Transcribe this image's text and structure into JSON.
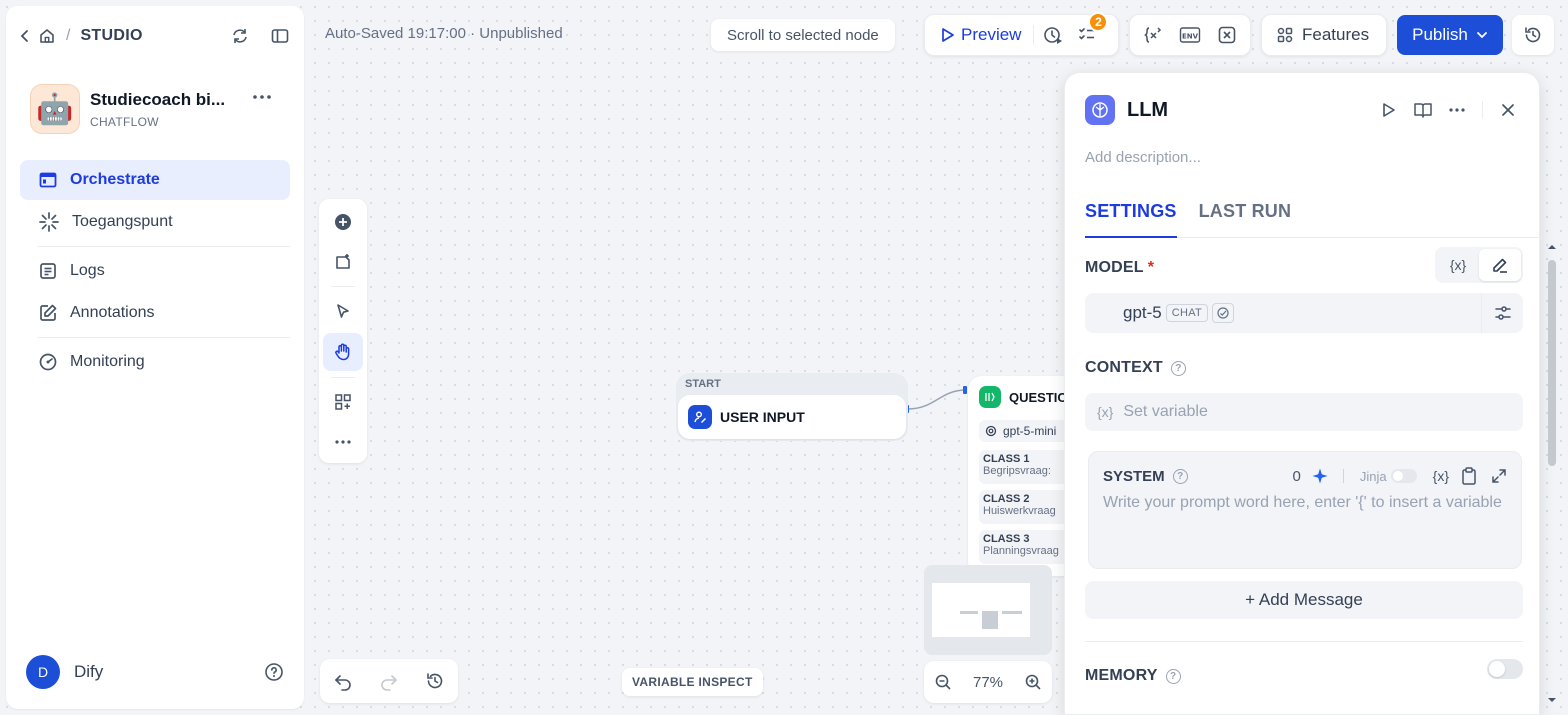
{
  "sidebar": {
    "breadcrumb": "STUDIO",
    "breadcrumb_sep": "/",
    "app_name": "Studiecoach bi...",
    "app_type": "CHATFLOW",
    "app_emoji": "🤖",
    "nav": [
      {
        "label": "Orchestrate",
        "active": true
      },
      {
        "label": "Toegangspunt"
      },
      {
        "label": "Logs"
      },
      {
        "label": "Annotations"
      },
      {
        "label": "Monitoring"
      }
    ],
    "user_initial": "D",
    "user_name": "Dify"
  },
  "header": {
    "autosave": "Auto-Saved 19:17:00 · Unpublished",
    "scroll_button": "Scroll to selected node",
    "preview": "Preview",
    "checklist_badge": "2",
    "features": "Features",
    "publish": "Publish"
  },
  "canvas": {
    "start_label": "START",
    "start_node": "USER INPUT",
    "question_node": "QUESTIO",
    "question_model": "gpt-5-mini",
    "classes": [
      {
        "title": "CLASS 1",
        "desc": "Begripsvraag: "
      },
      {
        "title": "CLASS 2",
        "desc": "Huiswerkvraag"
      },
      {
        "title": "CLASS 3",
        "desc": "Planningsvraag"
      }
    ],
    "zoom": "77%",
    "variable_inspect": "VARIABLE INSPECT"
  },
  "panel": {
    "title": "LLM",
    "description_placeholder": "Add description...",
    "tabs": [
      "SETTINGS",
      "LAST RUN"
    ],
    "model_label": "MODEL",
    "required_mark": "*",
    "var_symbol": "{x}",
    "model_name": "gpt-5",
    "model_tag": "CHAT",
    "context_label": "CONTEXT",
    "context_placeholder": "Set variable",
    "system_label": "SYSTEM",
    "system_count": "0",
    "jinja_label": "Jinja",
    "system_placeholder": "Write your prompt word here, enter '{' to insert a variable",
    "add_message": "+ Add Message",
    "memory_label": "MEMORY"
  },
  "colors": {
    "accent": "#1c3ce0",
    "publish": "#1d4ed8",
    "badge": "#f79009"
  }
}
